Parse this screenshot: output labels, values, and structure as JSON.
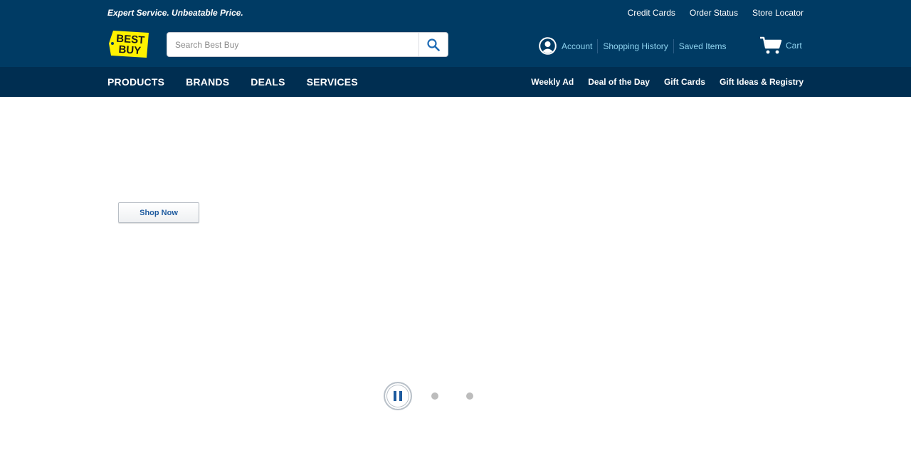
{
  "header": {
    "tagline": "Expert Service. Unbeatable Price.",
    "utility_links": [
      "Credit Cards",
      "Order Status",
      "Store Locator"
    ],
    "logo_text": "BEST BUY",
    "brand_colors": {
      "header_bg": "#003b64",
      "nav_bg": "#002e51",
      "logo_yellow": "#fff200",
      "link_blue": "#8fd4f0"
    }
  },
  "search": {
    "placeholder": "Search Best Buy",
    "value": "",
    "button_icon": "search-icon"
  },
  "account": {
    "icon": "user-circle-icon",
    "links": [
      "Account",
      "Shopping History",
      "Saved Items"
    ]
  },
  "cart": {
    "icon": "cart-icon",
    "label": "Cart"
  },
  "nav": {
    "main": [
      "PRODUCTS",
      "BRANDS",
      "DEALS",
      "SERVICES"
    ],
    "secondary": [
      "Weekly Ad",
      "Deal of the Day",
      "Gift Cards",
      "Gift Ideas & Registry"
    ]
  },
  "hero": {
    "cta_label": "Shop Now"
  },
  "carousel": {
    "pause_icon": "pause-icon",
    "slide_count": 3,
    "active_index": 0
  }
}
